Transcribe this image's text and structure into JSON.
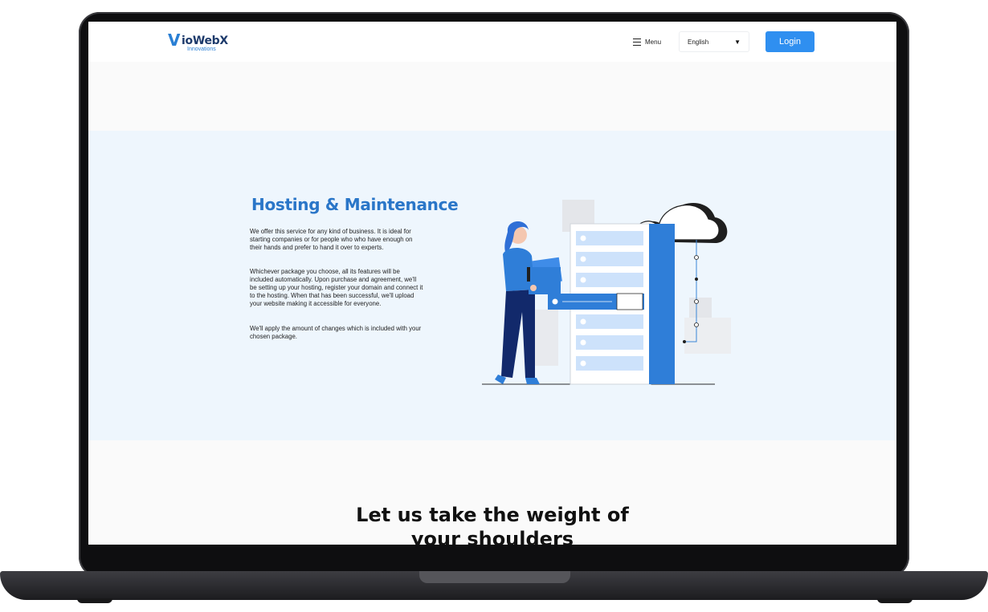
{
  "nav": {
    "logo_name": "ioWebX",
    "logo_mark": "V",
    "logo_sub": "Innovations",
    "menu_label": "Menu",
    "language": "English",
    "login_label": "Login"
  },
  "hero": {
    "title": "Hosting & Maintenance",
    "paragraphs": [
      "We offer this service for any kind of business. It is ideal for starting companies or for people who who have enough on their hands and prefer to hand it over to experts.",
      "Whichever package you choose, all its features will be included automatically. Upon purchase and agreement, we'll be setting up your hosting, register your domain and connect it to the hosting. When that has been successful, we'll upload your website making it accessible for everyone.",
      "We'll apply the amount of changes which is included with your chosen package."
    ],
    "illustration": "woman-with-folders-server-cloud-illustration"
  },
  "section2": {
    "title": "Let us take the weight of your shoulders"
  },
  "colors": {
    "accent": "#2f8ff0",
    "title_blue": "#2a76c8",
    "hero_bg": "#eef6fd"
  }
}
